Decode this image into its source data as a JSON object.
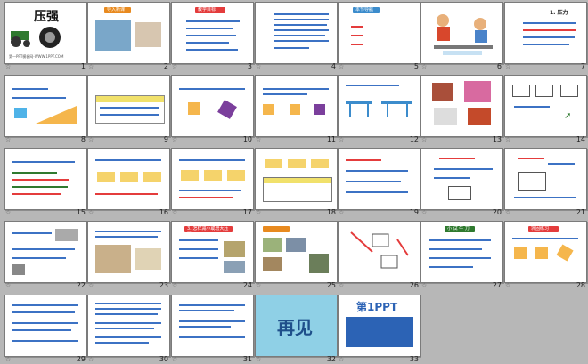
{
  "slide1_title": "压强",
  "slide1_footer": "第一PPT模板网-WWW.1PPT.COM",
  "slide2_bar": "导入新课",
  "slide3_bar": "教学目标",
  "slide5_bar": "本节导航",
  "slide6_label": "1. 压力",
  "slide24_bar": "3. 怎样减小或增大压强",
  "slide27_bar": "小 试 牛 刀",
  "slide28_bar": "巩固练习",
  "slide32_text": "再见",
  "slide33_logo": "第1PPT",
  "slide_numbers": [
    "1",
    "2",
    "3",
    "4",
    "5",
    "6",
    "7",
    "8",
    "9",
    "10",
    "11",
    "12",
    "13",
    "14",
    "15",
    "16",
    "17",
    "18",
    "19",
    "20",
    "21",
    "22",
    "23",
    "24",
    "25",
    "26",
    "27",
    "28",
    "29",
    "30",
    "31",
    "32",
    "33"
  ],
  "star_icon": "star-icon"
}
